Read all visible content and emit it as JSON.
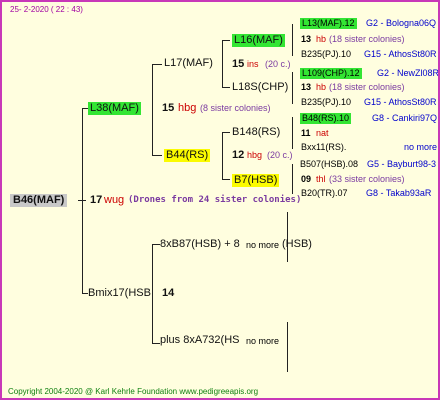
{
  "header_date": "25-   2-2020  (  22 :  43)",
  "footer": "Copyright 2004-2020 @ Karl Kehrle Foundation    www.pedigreeapis.org",
  "root": "B46(MAF)",
  "root_year": "17",
  "root_breed": "wug",
  "root_note": "(Drones from 24 sister colonies)",
  "queen": "L38(MAF)",
  "queen_year": "15",
  "queen_breed": "hbg",
  "queen_note": "(8 sister colonies)",
  "qm_mother": "L17(MAF)",
  "qm_year": "15",
  "qm_breed": "ins",
  "qm_note": "(20 c.)",
  "qmm": "L16(MAF)",
  "qmm_info": "13",
  "qmm_breed": "hb",
  "qmm_note": "(18 sister colonies)",
  "qmm_left": "L13(MAF).12",
  "qmm_left_right": "G2 - Bologna06Q",
  "qmm_bottom": "B235(PJ).10",
  "qmm_bottom_right": "G15 - AthosSt80R",
  "qmf": "L18S(CHP)",
  "qmf_top": "L109(CHP).12",
  "qmf_top_right": "G2 - NewZl08R",
  "qmf_info": "13",
  "qmf_breed": "hb",
  "qmf_note": "(18 sister colonies)",
  "qmf_bottom": "B235(PJ).10",
  "qmf_bottom_right": "G15 - AthosSt80R",
  "qf": "B44(RS)",
  "qf_year": "12",
  "qf_breed": "hbg",
  "qf_note": "(20 c.)",
  "qfm": "B148(RS)",
  "qfm_top": "B48(RS).10",
  "qfm_top_right": "G8 - Cankiri97Q",
  "qfm_info": "11",
  "qfm_breed": "nat",
  "qfm_bottom": "Bxx11(RS).",
  "qfm_bottom_right": "no more",
  "qff": "B7(HSB)",
  "qff_top": "B507(HSB).08",
  "qff_top_right": "G5 - Bayburt98-3",
  "qff_info": "09",
  "qff_breed": "thl",
  "qff_note": "(33 sister colonies)",
  "qff_bottom": "B20(TR).07",
  "qff_bottom_right": "G8 - Takab93aR",
  "drone_side": "Bmix17(HSB",
  "drone_year": "14",
  "d_m": "8xB87(HSB) + 8",
  "d_m_more": "no more",
  "d_m_tail": "(HSB)",
  "d_f": "plus 8xA732(HS",
  "d_f_more": "no more"
}
